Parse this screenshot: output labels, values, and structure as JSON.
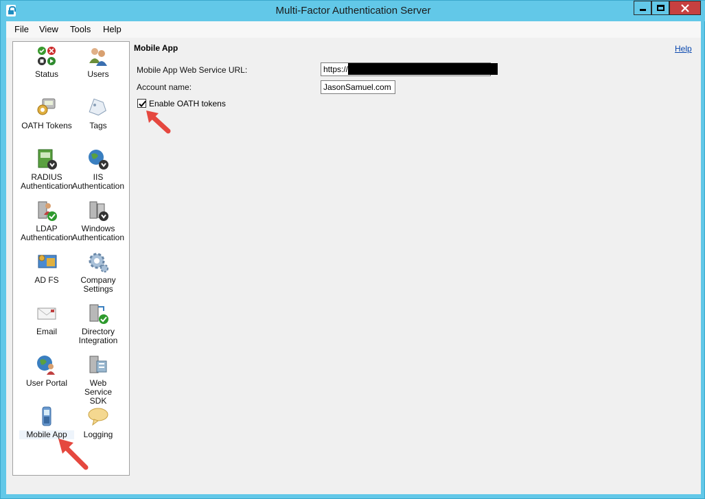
{
  "window": {
    "title": "Multi-Factor Authentication Server"
  },
  "menu": {
    "file": "File",
    "view": "View",
    "tools": "Tools",
    "help": "Help"
  },
  "nav": {
    "status": "Status",
    "users": "Users",
    "oath_tokens": "OATH Tokens",
    "tags": "Tags",
    "radius": "RADIUS Authentication",
    "iis": "IIS Authentication",
    "ldap": "LDAP Authentication",
    "windows": "Windows Authentication",
    "adfs": "AD FS",
    "company_settings": "Company Settings",
    "email": "Email",
    "directory_integration": "Directory Integration",
    "user_portal": "User Portal",
    "web_service_sdk": "Web Service SDK",
    "mobile_app": "Mobile App",
    "logging": "Logging",
    "selected": "Mobile App"
  },
  "main": {
    "section_title": "Mobile App",
    "help_link": "Help",
    "url_label": "Mobile App Web Service URL:",
    "url_value": "https://",
    "account_label": "Account name:",
    "account_value": "JasonSamuel.com",
    "oath_checkbox_label": "Enable OATH tokens",
    "oath_checked": true
  },
  "colors": {
    "titlebar": "#62c8e8",
    "close_button": "#c74040",
    "annotation_arrow": "#e5483f",
    "link": "#0645ad"
  }
}
